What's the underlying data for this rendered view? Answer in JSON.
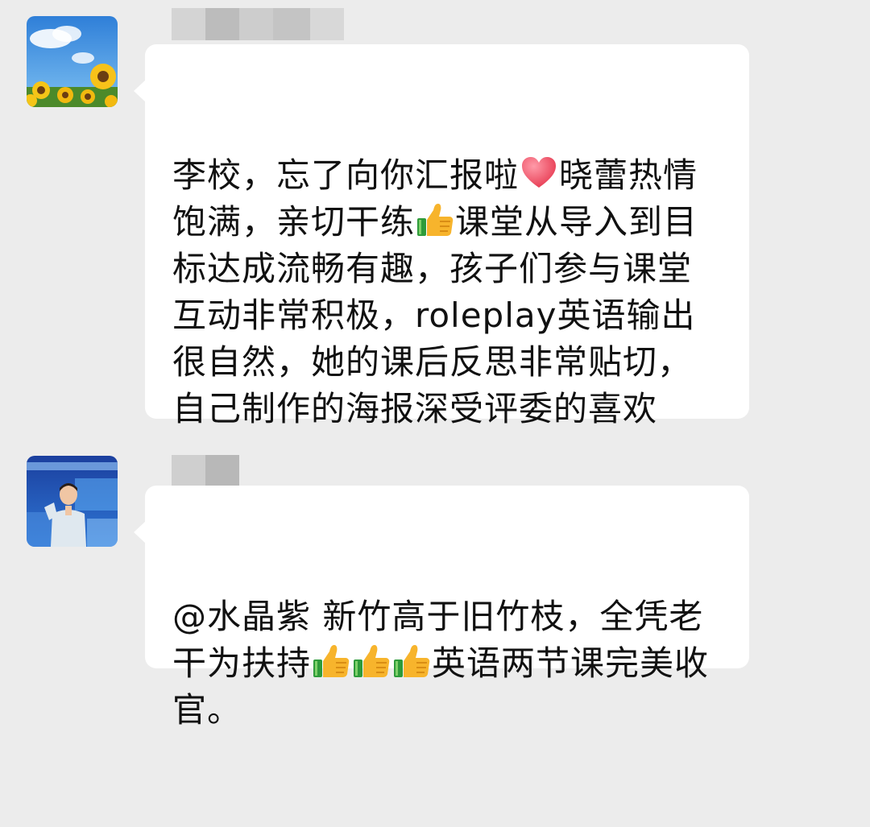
{
  "messages": [
    {
      "avatar": "sunflower-avatar",
      "sender_name_visible": false,
      "segments": [
        {
          "text": "李校，忘了向你汇报啦"
        },
        {
          "emoji": "heart-icon"
        },
        {
          "text": "晓蕾热情饱满，亲切干练"
        },
        {
          "emoji": "thumbs-up-icon"
        },
        {
          "text": "课堂从导入到目标达成流畅有趣，孩子们参与课堂互动非常积极，roleplay英语输出很自然，她的课后反思非常贴切，自己制作的海报深受评委的喜欢"
        }
      ]
    },
    {
      "avatar": "speaker-avatar",
      "sender_name_visible": false,
      "segments": [
        {
          "text": "@水晶紫 新竹高于旧竹枝，全凭老干为扶持"
        },
        {
          "emoji": "thumbs-up-icon"
        },
        {
          "emoji": "thumbs-up-icon"
        },
        {
          "emoji": "thumbs-up-icon"
        },
        {
          "text": "英语两节课完美收官。"
        }
      ]
    }
  ],
  "colors": {
    "background": "#ececec",
    "bubble": "#ffffff",
    "text": "#111111",
    "name_mask_light": "#cfcfcf",
    "name_mask_dark": "#b5b5b5"
  }
}
